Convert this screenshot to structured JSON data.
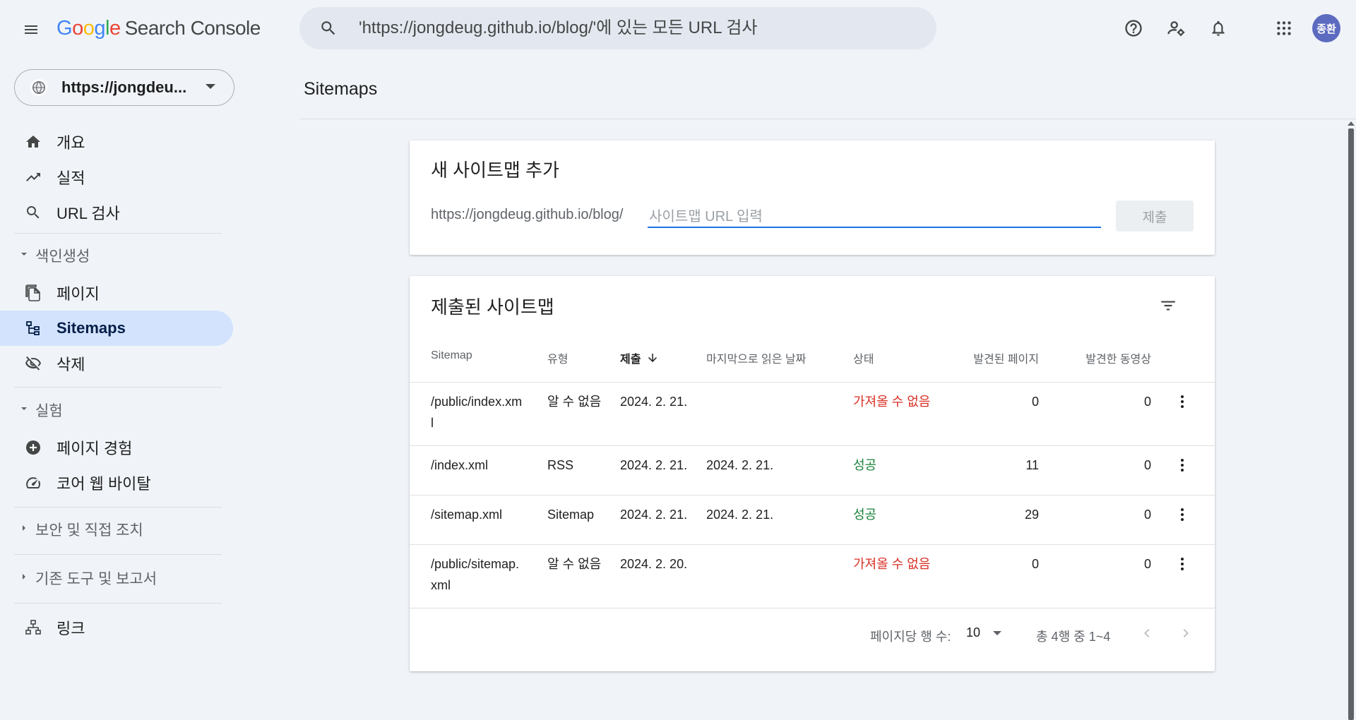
{
  "header": {
    "logo_letters": [
      "G",
      "o",
      "o",
      "g",
      "l",
      "e"
    ],
    "product": "Search Console",
    "search_placeholder": "'https://jongdeug.github.io/blog/'에 있는 모든 URL 검사",
    "avatar_text": "종환",
    "icons": [
      "menu-icon",
      "search-icon",
      "help-icon",
      "manage-users-icon",
      "notifications-icon",
      "apps-icon"
    ]
  },
  "sidebar": {
    "property": "https://jongdeu...",
    "items": [
      {
        "label": "개요",
        "icon": "home-icon"
      },
      {
        "label": "실적",
        "icon": "trending-up-icon"
      },
      {
        "label": "URL 검사",
        "icon": "search-icon"
      },
      {
        "label": "페이지",
        "icon": "pages-icon"
      },
      {
        "label": "Sitemaps",
        "icon": "sitemap-icon"
      },
      {
        "label": "삭제",
        "icon": "visibility-off-icon"
      },
      {
        "label": "페이지 경험",
        "icon": "add-circle-icon"
      },
      {
        "label": "코어 웹 바이탈",
        "icon": "speed-icon"
      },
      {
        "label": "링크",
        "icon": "links-icon"
      }
    ],
    "sections": {
      "indexing": "색인생성",
      "experience": "실험",
      "security": "보안 및 직접 조치",
      "legacy": "기존 도구 및 보고서"
    }
  },
  "main": {
    "title": "Sitemaps",
    "add_card": {
      "title": "새 사이트맵 추가",
      "prefix": "https://jongdeug.github.io/blog/",
      "input_placeholder": "사이트맵 URL 입력",
      "submit_label": "제출"
    },
    "submitted_card": {
      "title": "제출된 사이트맵",
      "columns": {
        "sitemap": "Sitemap",
        "type": "유형",
        "submitted": "제출",
        "last_read": "마지막으로 읽은 날짜",
        "status": "상태",
        "pages": "발견된 페이지",
        "videos": "발견한 동영상"
      },
      "rows": [
        {
          "sitemap_line1": "/public/index.xm",
          "sitemap_line2": "l",
          "type": "알 수 없음",
          "submitted": "2024. 2. 21.",
          "last_read": "",
          "status": "가져올 수 없음",
          "status_kind": "error",
          "pages": "0",
          "videos": "0"
        },
        {
          "sitemap_line1": "/index.xml",
          "sitemap_line2": "",
          "type": "RSS",
          "submitted": "2024. 2. 21.",
          "last_read": "2024. 2. 21.",
          "status": "성공",
          "status_kind": "success",
          "pages": "11",
          "videos": "0"
        },
        {
          "sitemap_line1": "/sitemap.xml",
          "sitemap_line2": "",
          "type": "Sitemap",
          "submitted": "2024. 2. 21.",
          "last_read": "2024. 2. 21.",
          "status": "성공",
          "status_kind": "success",
          "pages": "29",
          "videos": "0"
        },
        {
          "sitemap_line1": "/public/sitemap.",
          "sitemap_line2": "xml",
          "type": "알 수 없음",
          "submitted": "2024. 2. 20.",
          "last_read": "",
          "status": "가져올 수 없음",
          "status_kind": "error",
          "pages": "0",
          "videos": "0"
        }
      ],
      "pagination": {
        "rows_per_page_label": "페이지당 행 수:",
        "rows_per_page_value": "10",
        "range": "총 4행 중 1~4"
      }
    }
  },
  "colors": {
    "accent": "#1a73e8",
    "active_nav": "#d3e3fd",
    "error": "#d93025",
    "success": "#188038",
    "background": "#f0f4f9"
  }
}
